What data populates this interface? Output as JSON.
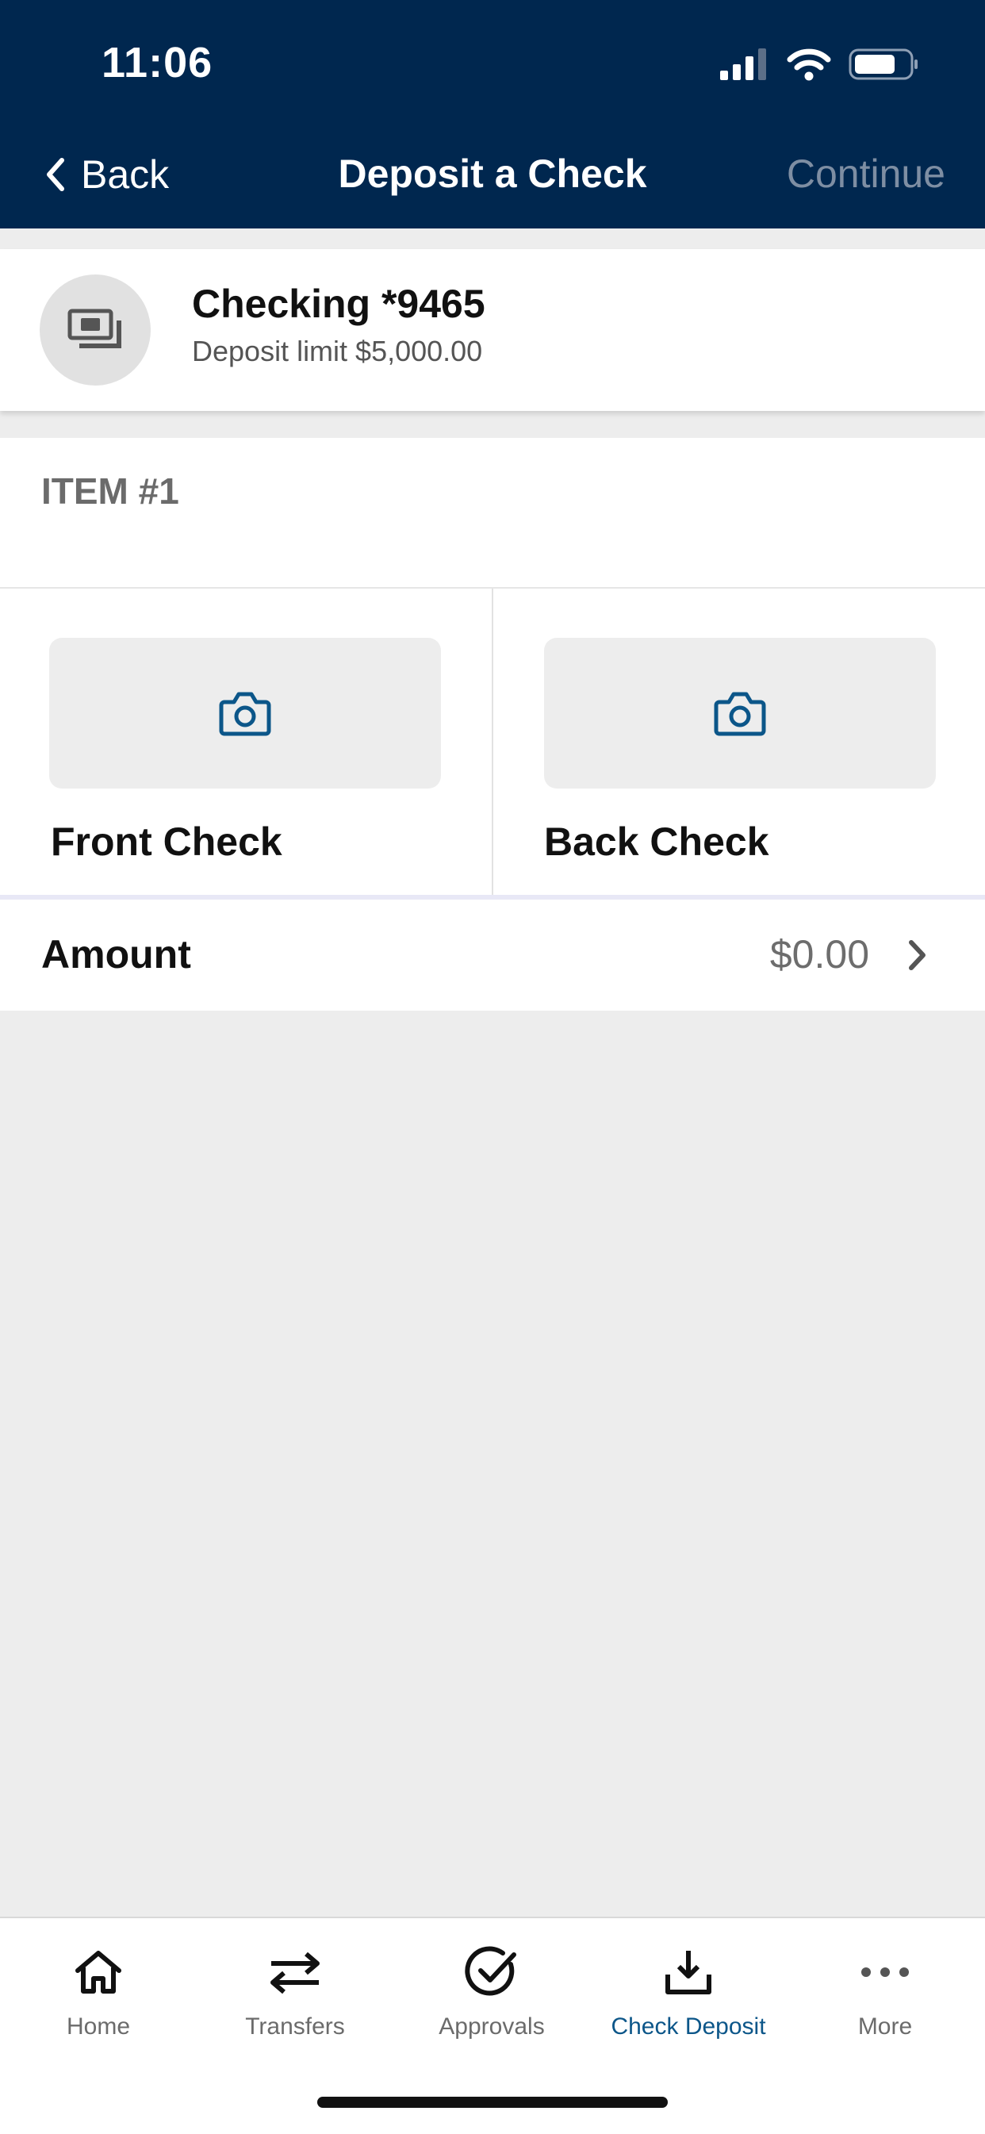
{
  "status_bar": {
    "time": "11:06"
  },
  "nav": {
    "back_label": "Back",
    "title": "Deposit a Check",
    "continue_label": "Continue"
  },
  "account": {
    "name": "Checking *9465",
    "limit": "Deposit limit $5,000.00",
    "icon": "money-stack-icon"
  },
  "item": {
    "title": "ITEM #1"
  },
  "capture": {
    "front_label": "Front Check",
    "back_label": "Back Check",
    "icon": "camera-icon"
  },
  "amount": {
    "label": "Amount",
    "value": "$0.00"
  },
  "tabs": [
    {
      "label": "Home",
      "icon": "home-icon"
    },
    {
      "label": "Transfers",
      "icon": "transfer-arrows-icon"
    },
    {
      "label": "Approvals",
      "icon": "check-circle-icon"
    },
    {
      "label": "Check Deposit",
      "icon": "download-tray-icon",
      "active": true
    },
    {
      "label": "More",
      "icon": "more-dots-icon"
    }
  ],
  "colors": {
    "header": "#00274f",
    "accent": "#0c5689",
    "background": "#ededed",
    "disabled_text": "#7e8ea3"
  }
}
